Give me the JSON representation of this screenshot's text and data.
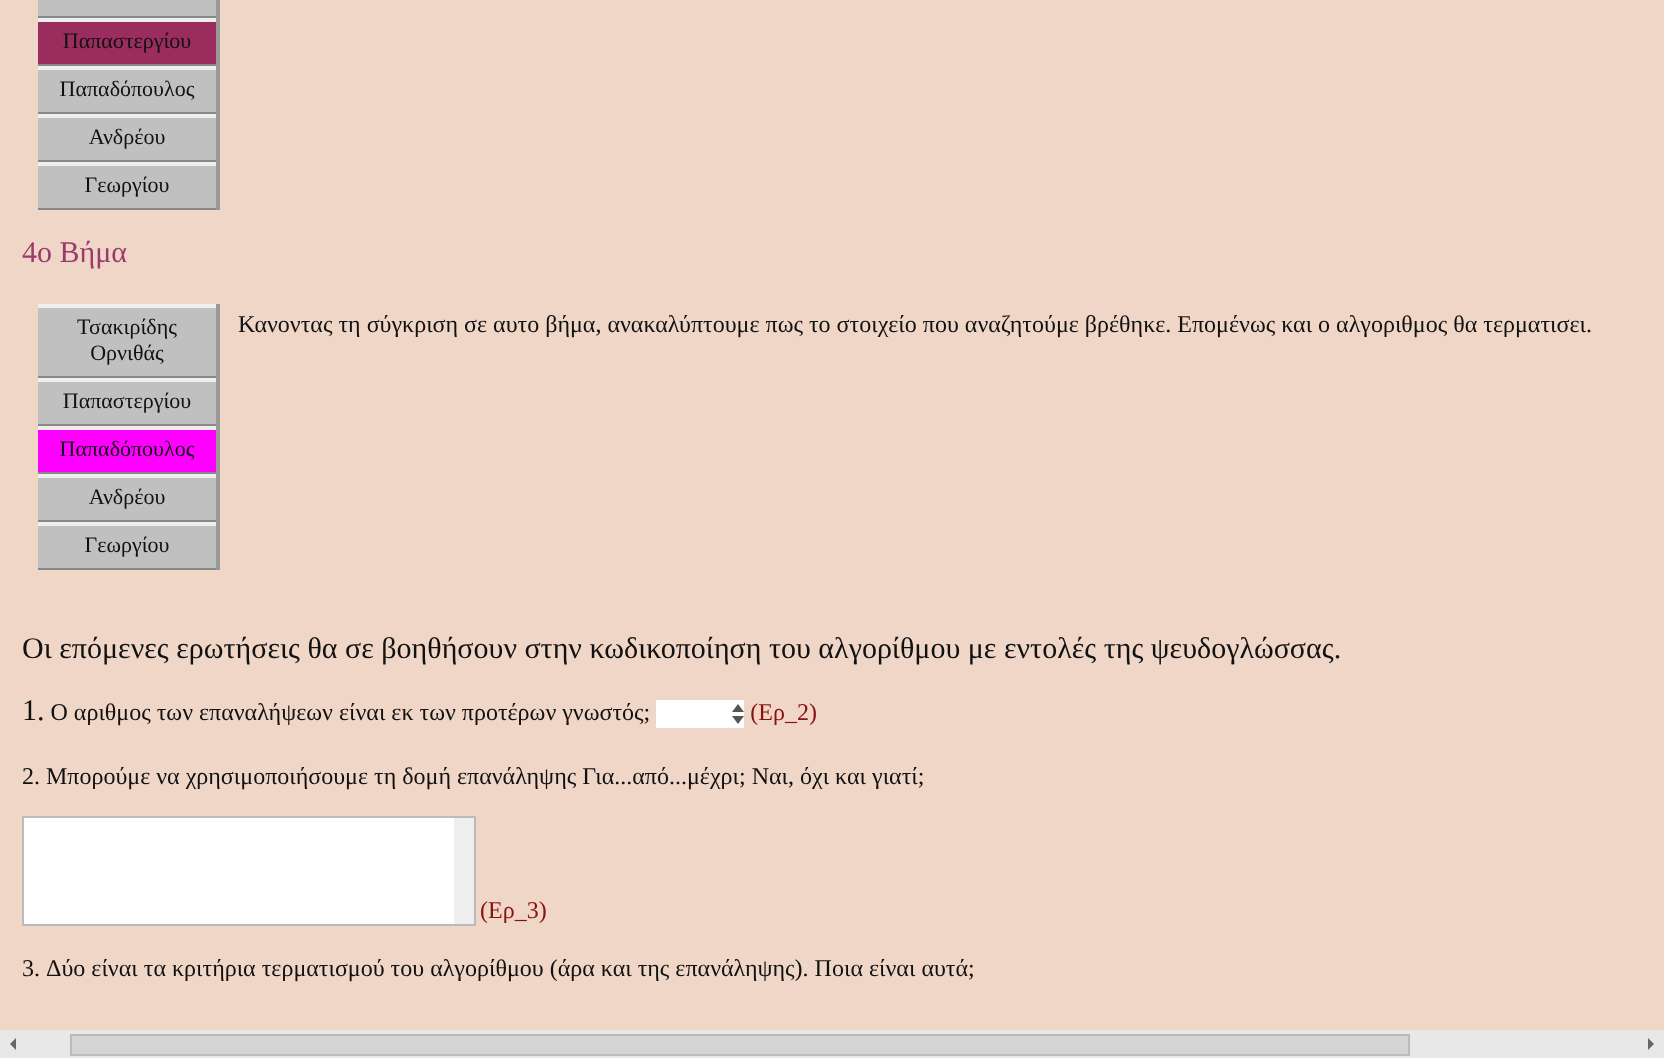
{
  "top_list": {
    "items": [
      {
        "label": "Παπαστεργίου",
        "color": "#9b2d5e"
      },
      {
        "label": "Παπαδόπουλος",
        "color": "#c0c0c0"
      },
      {
        "label": "Ανδρέου",
        "color": "#c0c0c0"
      },
      {
        "label": "Γεωργίου",
        "color": "#c0c0c0"
      }
    ]
  },
  "step": {
    "heading": "4ο Βήμα",
    "list": {
      "items": [
        {
          "label": "Τσακιρίδης Ορνιθάς",
          "color": "#c0c0c0"
        },
        {
          "label": "Παπαστεργίου",
          "color": "#c0c0c0"
        },
        {
          "label": "Παπαδόπουλος",
          "color": "#ff00ff"
        },
        {
          "label": "Ανδρέου",
          "color": "#c0c0c0"
        },
        {
          "label": "Γεωργίου",
          "color": "#c0c0c0"
        }
      ]
    },
    "text": "Κανοντας τη σύγκριση σε αυτο βήμα, ανακαλύπτουμε πως το στοιχείο που αναζητούμε βρέθηκε. Επομένως και ο αλγοριθμος θα τερματισει."
  },
  "intro": "Οι επόμενες ερωτήσεις θα σε βοηθήσουν στην κωδικοποίηση του αλγορίθμου με εντολές της ψευδογλώσσας.",
  "questions": [
    {
      "kind": "spinner",
      "number": "1.",
      "text": "Ο αριθμος των επαναλήψεων είναι εκ των προτέρων γνωστός;",
      "ref": "(Ερ_2)"
    },
    {
      "kind": "textarea",
      "number": "2.",
      "text": "Μπορούμε να χρησιμοποιήσουμε τη δομή επανάληψης Για...από...μέχρι; Ναι, όχι και γιατί;",
      "ref": "(Ερ_3)"
    },
    {
      "kind": "none",
      "number": "3.",
      "text": "Δύο είναι τα κριτήρια τερματισμού του αλγορίθμου (άρα και της επανάληψης). Ποια είναι αυτά;"
    }
  ]
}
